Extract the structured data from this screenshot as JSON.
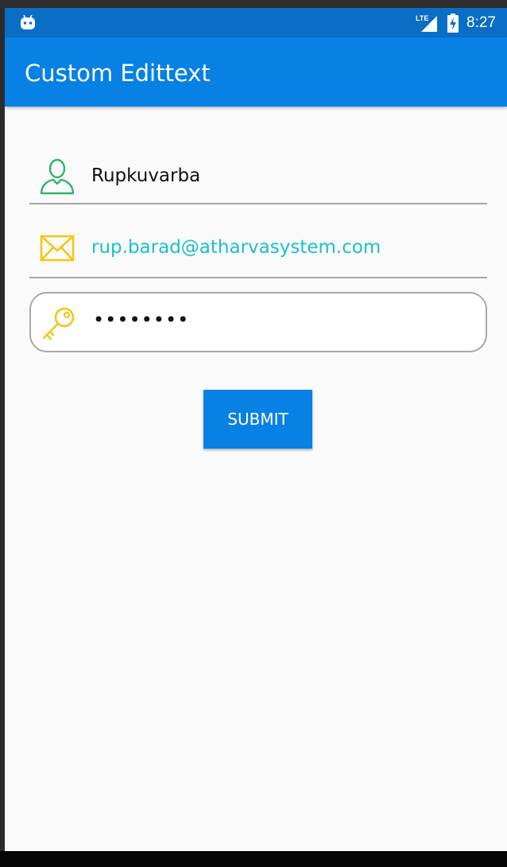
{
  "status_bar": {
    "time": "8:27",
    "network_label": "LTE",
    "icons": [
      "android-icon",
      "lte-signal-icon",
      "battery-charging-icon"
    ]
  },
  "app_bar": {
    "title": "Custom Edittext"
  },
  "form": {
    "name_field": {
      "value": "Rupkuvarba",
      "icon": "user-icon",
      "icon_color": "#2fb36a"
    },
    "email_field": {
      "value": "rup.barad@atharvasystem.com",
      "icon": "envelope-icon",
      "icon_color": "#f5c518",
      "text_color": "#1bbfcf"
    },
    "password_field": {
      "value": "••••••••",
      "icon": "key-icon",
      "icon_color": "#f5c518"
    },
    "submit_label": "SUBMIT"
  },
  "colors": {
    "status_bar": "#0a6ec6",
    "app_bar": "#0781e3",
    "button": "#0781e3",
    "background": "#fafafa"
  }
}
